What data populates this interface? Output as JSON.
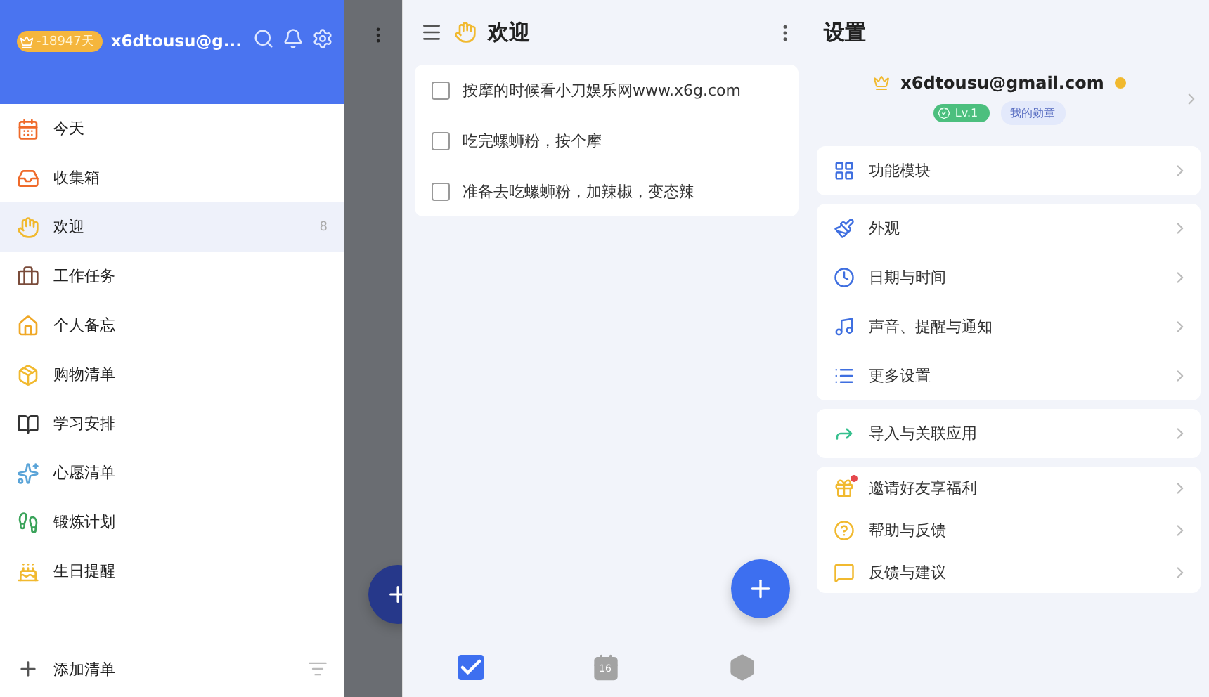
{
  "drawer": {
    "vip_days": "-18947天",
    "account": "x6dtousu@g...",
    "items": [
      {
        "label": "今天",
        "selected": false
      },
      {
        "label": "收集箱",
        "selected": false
      },
      {
        "label": "欢迎",
        "selected": true,
        "count": "8"
      },
      {
        "label": "工作任务",
        "selected": false
      },
      {
        "label": "个人备忘",
        "selected": false
      },
      {
        "label": "购物清单",
        "selected": false
      },
      {
        "label": "学习安排",
        "selected": false
      },
      {
        "label": "心愿清单",
        "selected": false
      },
      {
        "label": "锻炼计划",
        "selected": false
      },
      {
        "label": "生日提醒",
        "selected": false
      }
    ],
    "add_list": "添加清单"
  },
  "list": {
    "title": "欢迎",
    "tasks": [
      {
        "text": "按摩的时候看小刀娱乐网www.x6g.com",
        "checked": false
      },
      {
        "text": "吃完螺蛳粉，按个摩",
        "checked": false
      },
      {
        "text": "准备去吃螺蛳粉，加辣椒，变态辣",
        "checked": false
      }
    ],
    "bottom_nav": [
      {
        "kind": "tasks",
        "selected": true
      },
      {
        "kind": "calendar",
        "label": "16",
        "selected": false
      },
      {
        "kind": "more",
        "selected": false
      }
    ]
  },
  "settings": {
    "title": "设置",
    "email": "x6dtousu@gmail.com",
    "level": "Lv.1",
    "medals": "我的勋章",
    "groups": [
      [
        {
          "label": "功能模块",
          "dot": false
        }
      ],
      [
        {
          "label": "外观",
          "dot": false
        },
        {
          "label": "日期与时间",
          "dot": false
        },
        {
          "label": "声音、提醒与通知",
          "dot": false
        },
        {
          "label": "更多设置",
          "dot": false
        }
      ],
      [
        {
          "label": "导入与关联应用",
          "dot": false
        }
      ],
      [
        {
          "label": "邀请好友享福利",
          "dot": true
        },
        {
          "label": "帮助与反馈",
          "dot": false
        },
        {
          "label": "反馈与建议",
          "dot": false
        }
      ]
    ]
  }
}
